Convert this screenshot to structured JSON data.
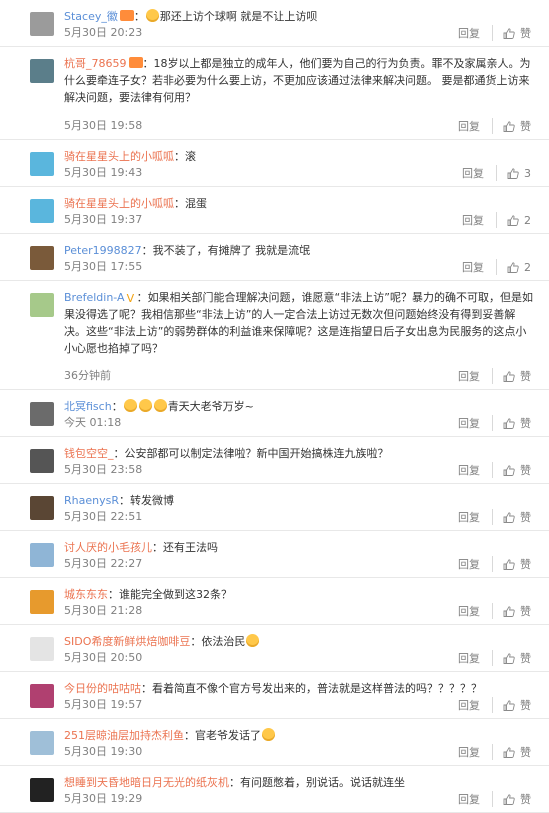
{
  "reply_label": "回复",
  "comments": [
    {
      "user": "Stacey_徽",
      "user_color": "blue",
      "badge": "fire",
      "text": "那还上访个球啊 就是不让上访呗",
      "emoji_before": true,
      "time": "5月30日 20:23",
      "likes": "赞",
      "height": 47,
      "avatar_color": "#9b9b9b"
    },
    {
      "user": "杭哥_78659",
      "user_color": "orange",
      "badge": "fire",
      "text": "18岁以上都是独立的成年人，他们要为自己的行为负责。罪不及家属亲人。为什么要牵连子女？若非必要为什么要上访，不更加应该通过法律来解决问题。 要是都通货上访来解决问题，要法律有何用？",
      "time": "5月30日 19:58",
      "likes": "赞",
      "height": 93,
      "avatar_color": "#5b7e8a"
    },
    {
      "user": "骑在星星头上的小呱呱",
      "user_color": "orange",
      "text": "滚",
      "time": "5月30日 19:43",
      "likes": "3",
      "height": 47,
      "avatar_color": "#5ab6dd"
    },
    {
      "user": "骑在星星头上的小呱呱",
      "user_color": "orange",
      "text": "混蛋",
      "time": "5月30日 19:37",
      "likes": "2",
      "height": 47,
      "avatar_color": "#5ab6dd"
    },
    {
      "user": "Peter1998827",
      "user_color": "blue",
      "text": "我不装了，有摊牌了 我就是流氓",
      "time": "5月30日 17:55",
      "likes": "2",
      "height": 47,
      "avatar_color": "#7a5a3a"
    },
    {
      "user": "Brefeldin-A",
      "user_color": "blue",
      "badge": "v",
      "text": "如果相关部门能合理解决问题，谁愿意“非法上访”呢？暴力的确不可取，但是如果没得选了呢？我相信那些“非法上访”的人一定合法上访过无数次但问题始终没有得到妥善解决。这些“非法上访”的弱势群体的利益谁来保障呢？这是连指望日后子女出息为民服务的这点小小心愿也掐掉了吗？",
      "time": "36分钟前",
      "likes": "赞",
      "height": 109,
      "avatar_color": "#a6c98a"
    },
    {
      "user": "北冥fisch",
      "user_color": "blue",
      "text": "青天大老爷万岁~",
      "emoji_before": true,
      "emoji_count": 3,
      "time": "今天 01:18",
      "likes": "赞",
      "height": 47,
      "avatar_color": "#6b6b6b"
    },
    {
      "user": "钱包空空_",
      "user_color": "orange",
      "text": "公安部都可以制定法律啦？新中国开始搞株连九族啦？",
      "time": "5月30日 23:58",
      "likes": "赞",
      "height": 47,
      "avatar_color": "#555"
    },
    {
      "user": "RhaenysR",
      "user_color": "blue",
      "text": "转发微博",
      "time": "5月30日 22:51",
      "likes": "赞",
      "height": 47,
      "avatar_color": "#5a4634"
    },
    {
      "user": "讨人厌的小毛孩儿",
      "user_color": "orange",
      "text": "还有王法吗",
      "time": "5月30日 22:27",
      "likes": "赞",
      "height": 47,
      "avatar_color": "#8fb5d6"
    },
    {
      "user": "城东东东",
      "user_color": "orange",
      "text": "谁能完全做到这32条？",
      "time": "5月30日 21:28",
      "likes": "赞",
      "height": 47,
      "avatar_color": "#e79a2d"
    },
    {
      "user": "SIDO希度新鲜烘焙咖啡豆",
      "user_color": "orange",
      "text": "依法治民",
      "emoji_after": true,
      "time": "5月30日 20:50",
      "likes": "赞",
      "height": 47,
      "avatar_color": "#e4e4e4"
    },
    {
      "user": "今日份的咕咕咕",
      "user_color": "orange",
      "text": "看着简直不像个官方号发出来的，普法就是这样普法的吗？？？？？",
      "time": "5月30日 19:57",
      "likes": "赞",
      "height": 47,
      "avatar_color": "#b04070"
    },
    {
      "user": "251层晾油层加持杰利鱼",
      "user_color": "orange",
      "text": "官老爷发话了",
      "emoji_after": true,
      "time": "5月30日 19:30",
      "likes": "赞",
      "height": 47,
      "avatar_color": "#9fbfd8"
    },
    {
      "user": "想睡到天昏地暗日月无光的纸灰机",
      "user_color": "orange",
      "text": "有问题憋着，别说话。说话就连坐",
      "time": "5月30日 19:29",
      "likes": "赞",
      "height": 47,
      "avatar_color": "#222"
    }
  ]
}
